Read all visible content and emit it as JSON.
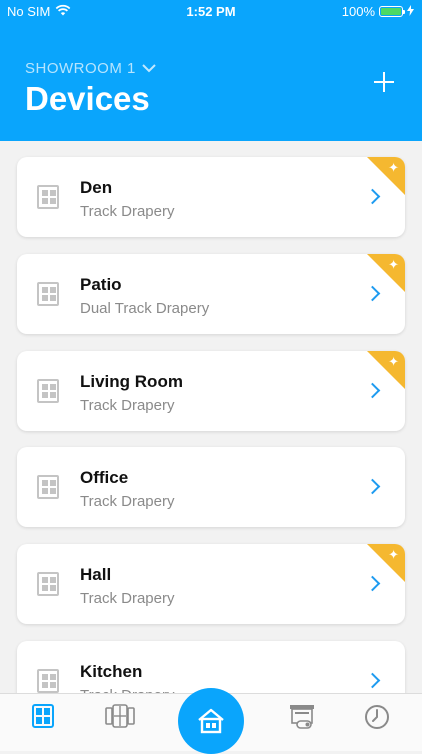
{
  "status_bar": {
    "carrier": "No SIM",
    "time": "1:52 PM",
    "battery_text": "100%"
  },
  "header": {
    "location": "SHOWROOM 1",
    "title": "Devices",
    "add_label": "+"
  },
  "devices": [
    {
      "name": "Den",
      "type": "Track Drapery",
      "badge": true
    },
    {
      "name": "Patio",
      "type": "Dual Track Drapery",
      "badge": true
    },
    {
      "name": "Living Room",
      "type": "Track Drapery",
      "badge": true
    },
    {
      "name": "Office",
      "type": "Track Drapery",
      "badge": false
    },
    {
      "name": "Hall",
      "type": "Track Drapery",
      "badge": true
    },
    {
      "name": "Kitchen",
      "type": "Track Drapery",
      "badge": false
    }
  ],
  "tabs": [
    {
      "name": "devices-tab",
      "icon": "window-icon",
      "active": true
    },
    {
      "name": "groups-tab",
      "icon": "group-window-icon",
      "active": false
    },
    {
      "name": "home-tab",
      "icon": "house-icon",
      "active": false
    },
    {
      "name": "scenes-tab",
      "icon": "scene-icon",
      "active": false
    },
    {
      "name": "schedules-tab",
      "icon": "clock-icon",
      "active": false
    }
  ],
  "colors": {
    "accent": "#0aa5fc",
    "badge": "#f5b830",
    "chevron": "#1e9bf0"
  }
}
